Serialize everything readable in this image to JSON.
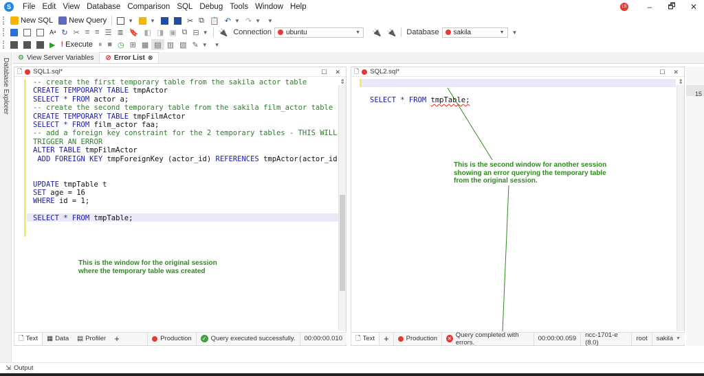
{
  "menu": [
    "File",
    "Edit",
    "View",
    "Database",
    "Comparison",
    "SQL",
    "Debug",
    "Tools",
    "Window",
    "Help"
  ],
  "user_initials": "LS",
  "window_controls": {
    "minimize": "–",
    "restore": "🗗",
    "close": "✕"
  },
  "toolbar1": {
    "new_sql": "New SQL",
    "new_query": "New Query"
  },
  "toolbar2": {
    "connection_label": "Connection",
    "connection_value": "ubuntu",
    "database_label": "Database",
    "database_value": "sakila"
  },
  "toolbar3": {
    "execute": "Execute"
  },
  "left_strip": {
    "label": "Database Explorer"
  },
  "doc_tabs": [
    {
      "label": "View Server Variables"
    },
    {
      "label": "Error List"
    }
  ],
  "pane1": {
    "title": "SQL1.sql*",
    "code": [
      [
        [
          "cm",
          "-- create the first temporary table from the sakila actor table"
        ]
      ],
      [
        [
          "kw",
          "CREATE TEMPORARY TABLE "
        ],
        [
          "tx",
          "tmpActor"
        ]
      ],
      [
        [
          "kw",
          "SELECT * FROM "
        ],
        [
          "tx",
          "actor a;"
        ]
      ],
      [
        [
          "cm",
          "-- create the second temporary table from the sakila film_actor table"
        ]
      ],
      [
        [
          "kw",
          "CREATE TEMPORARY TABLE "
        ],
        [
          "tx",
          "tmpFilmActor"
        ]
      ],
      [
        [
          "kw",
          "SELECT * FROM "
        ],
        [
          "tx",
          "film_actor faa;"
        ]
      ],
      [
        [
          "cm",
          "-- add a foreign key constraint for the 2 temporary tables - THIS WILL"
        ]
      ],
      [
        [
          "cm",
          "TRIGGER AN ERROR"
        ]
      ],
      [
        [
          "kw",
          "ALTER TABLE "
        ],
        [
          "tx",
          "tmpFilmActor"
        ]
      ],
      [
        [
          "kw",
          " ADD FOREIGN KEY "
        ],
        [
          "tx",
          "tmpForeignKey (actor_id) "
        ],
        [
          "kw",
          "REFERENCES "
        ],
        [
          "tx",
          "tmpActor(actor_id);"
        ]
      ],
      [],
      [],
      [
        [
          "kw",
          "UPDATE "
        ],
        [
          "tx",
          "tmpTable t"
        ]
      ],
      [
        [
          "kw",
          "SET "
        ],
        [
          "tx",
          "age = 16"
        ]
      ],
      [
        [
          "kw",
          "WHERE "
        ],
        [
          "tx",
          "id = 1;"
        ]
      ],
      [],
      [
        [
          "kw",
          "SELECT * FROM "
        ],
        [
          "tx",
          "tmpTable;"
        ]
      ]
    ],
    "annotation_line1": "This is the window for the original session",
    "annotation_line2": "where the temporary table was created",
    "status": {
      "tab_text": "Text",
      "tab_data": "Data",
      "tab_profiler": "Profiler",
      "add": "+",
      "env": "Production",
      "message": "Query executed successfully.",
      "time": "00:00:00.010"
    }
  },
  "pane2": {
    "title": "SQL2.sql*",
    "code_kw": "SELECT * FROM ",
    "code_tx": "tmpTable;",
    "annotation_line1": "This is the second window for another session",
    "annotation_line2": "showing an error querying the temporary table",
    "annotation_line3": "from the original session.",
    "status": {
      "tab_text": "Text",
      "add": "+",
      "env": "Production",
      "message": "Query completed with errors.",
      "time": "00:00:00.059",
      "server": "ncc-1701-e (8.0)",
      "user": "root",
      "db": "sakila"
    }
  },
  "right_column_number": "15",
  "output": {
    "label": "Output"
  },
  "colors": {
    "keyword": "#1a1aa6",
    "comment": "#2f7d2f",
    "annotation": "#2e8b1e",
    "production": "#e53935",
    "success": "#43a047"
  }
}
